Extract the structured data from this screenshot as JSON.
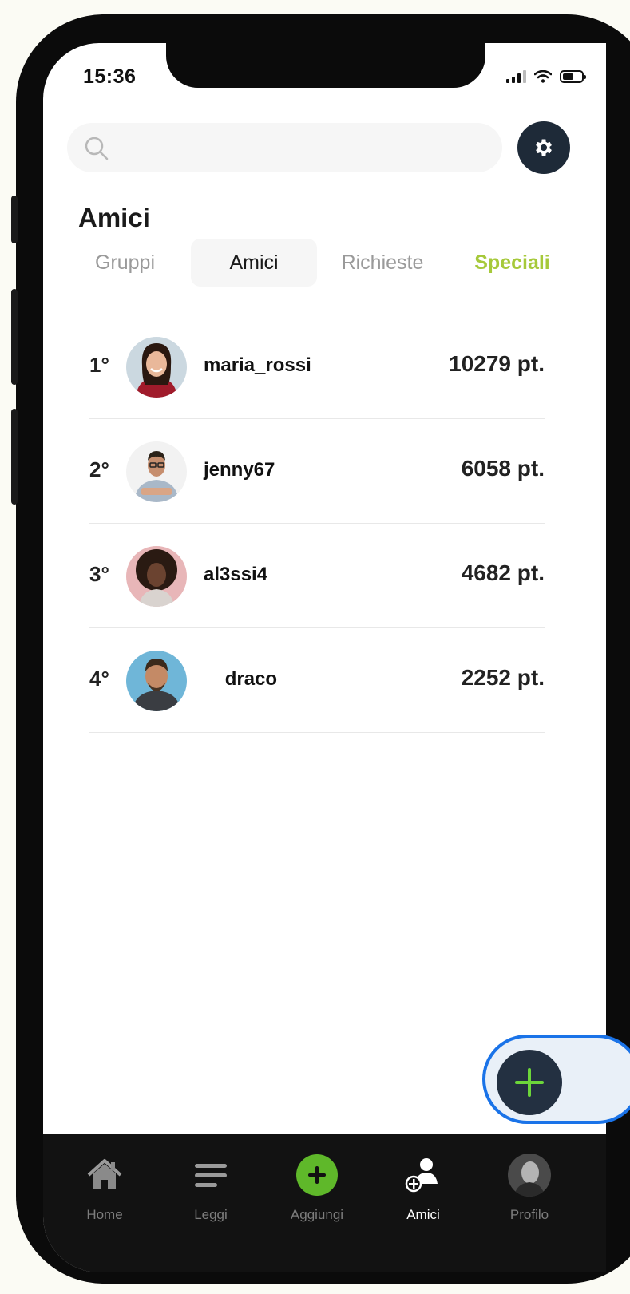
{
  "status_bar": {
    "time": "15:36"
  },
  "search": {
    "placeholder": ""
  },
  "page": {
    "title": "Amici"
  },
  "tabs": [
    {
      "label": "Gruppi"
    },
    {
      "label": "Amici"
    },
    {
      "label": "Richieste"
    },
    {
      "label": "Speciali"
    }
  ],
  "leaderboard": [
    {
      "rank": "1°",
      "username": "maria_rossi",
      "points": "10279 pt."
    },
    {
      "rank": "2°",
      "username": "jenny67",
      "points": "6058 pt."
    },
    {
      "rank": "3°",
      "username": "al3ssi4",
      "points": "4682 pt."
    },
    {
      "rank": "4°",
      "username": "__draco",
      "points": "2252 pt."
    }
  ],
  "bottom_nav": [
    {
      "label": "Home",
      "icon": "home-icon"
    },
    {
      "label": "Leggi",
      "icon": "menu-lines-icon"
    },
    {
      "label": "Aggiungi",
      "icon": "plus-circle-icon"
    },
    {
      "label": "Amici",
      "icon": "add-friend-icon"
    },
    {
      "label": "Profilo",
      "icon": "profile-avatar"
    }
  ],
  "colors": {
    "accent_green": "#5fb82a",
    "special_tab": "#a6c93a",
    "dark_button": "#1e2a38",
    "highlight_border": "#1a73e8"
  }
}
